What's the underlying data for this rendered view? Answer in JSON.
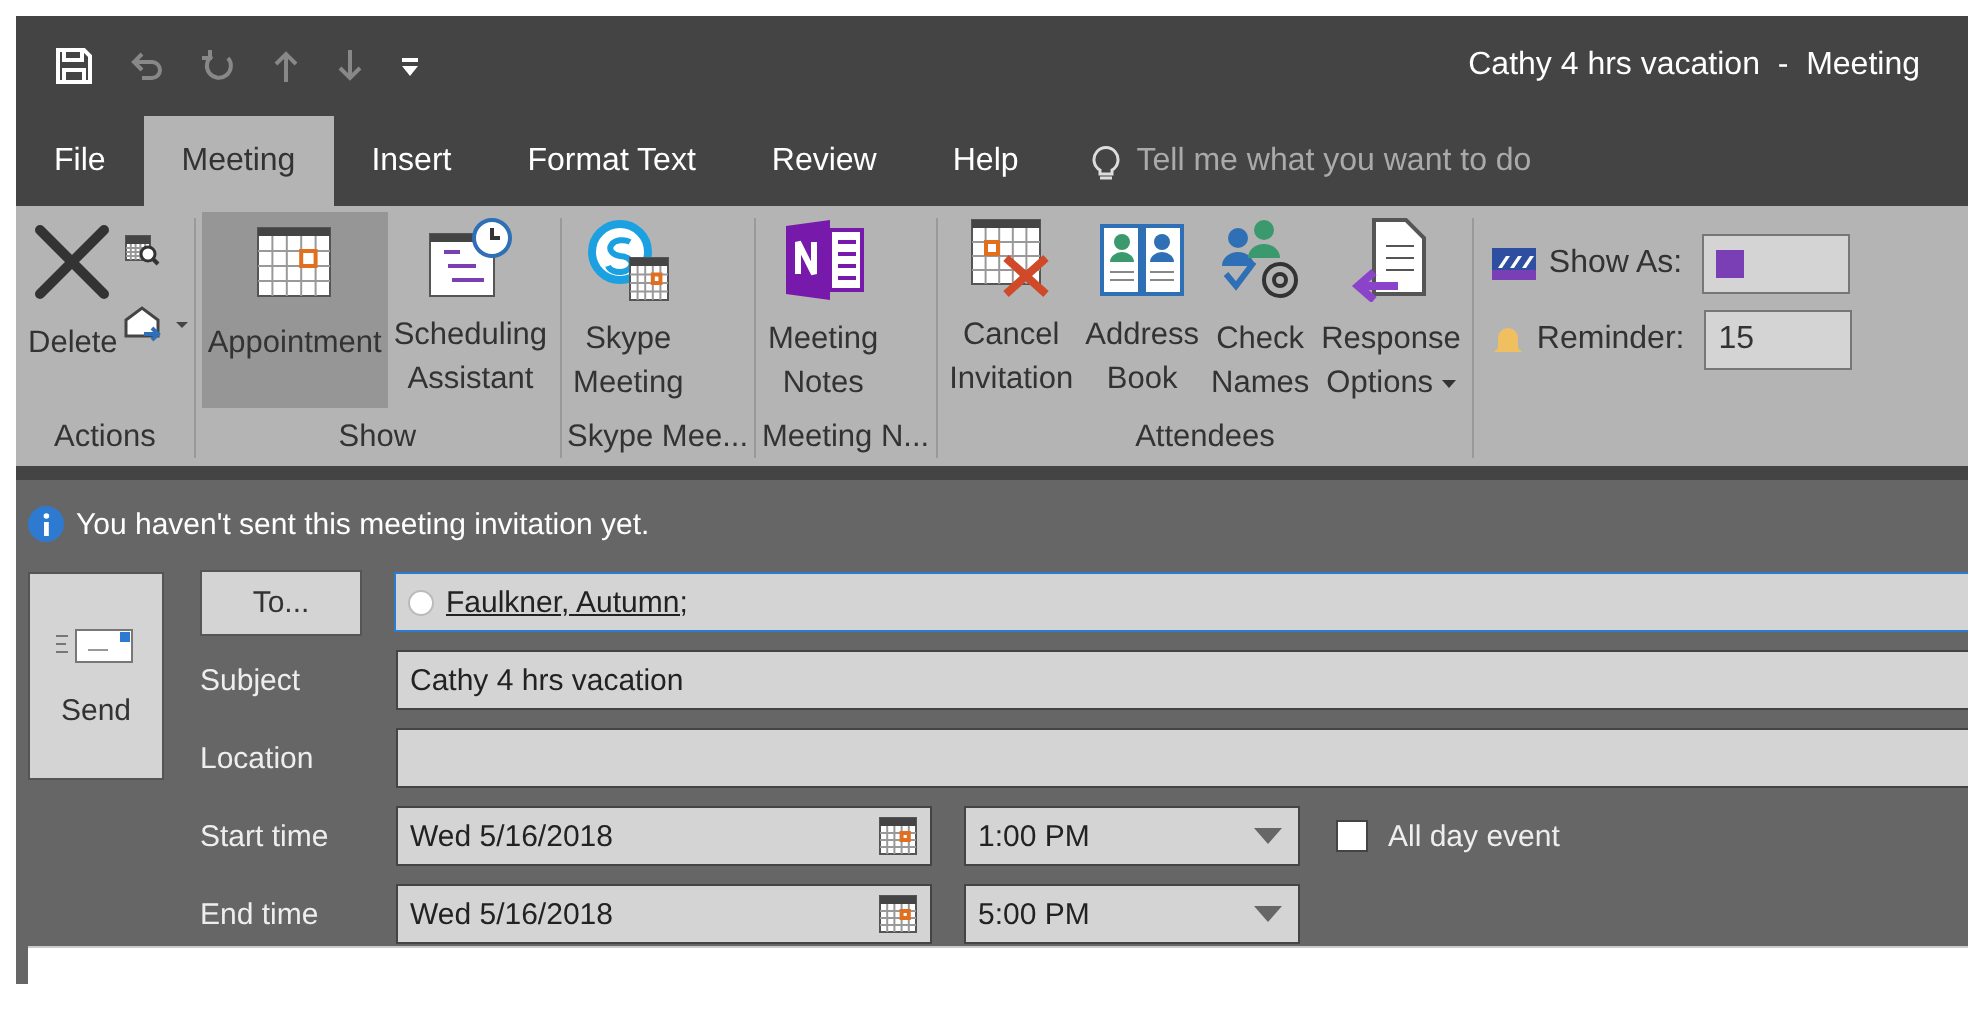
{
  "window": {
    "title": "Cathy 4 hrs vacation  -  Meeting"
  },
  "quick_access": [
    {
      "kind": "save",
      "disabled": false
    },
    {
      "kind": "undo",
      "disabled": true
    },
    {
      "kind": "redo",
      "disabled": true
    },
    {
      "kind": "up",
      "disabled": true
    },
    {
      "kind": "down",
      "disabled": true
    },
    {
      "kind": "customize",
      "disabled": false
    }
  ],
  "tabs": [
    {
      "label": "File",
      "selected": false
    },
    {
      "label": "Meeting",
      "selected": true
    },
    {
      "label": "Insert",
      "selected": false
    },
    {
      "label": "Format Text",
      "selected": false
    },
    {
      "label": "Review",
      "selected": false
    },
    {
      "label": "Help",
      "selected": false
    }
  ],
  "tell_me": {
    "placeholder": "Tell me what you want to do"
  },
  "ribbon": {
    "groups": [
      {
        "label": "Actions",
        "kind": "actions",
        "buttons": [
          {
            "kind": "delete",
            "lines": [
              "Delete"
            ],
            "selected": false
          }
        ]
      },
      {
        "label": "Show",
        "kind": "large",
        "buttons": [
          {
            "kind": "appointment",
            "lines": [
              "Appointment"
            ],
            "selected": true
          },
          {
            "kind": "scheduling",
            "lines": [
              "Scheduling",
              "Assistant"
            ],
            "selected": false
          }
        ]
      },
      {
        "label": "Skype Mee...",
        "kind": "large",
        "buttons": [
          {
            "kind": "skype",
            "lines": [
              "Skype",
              "Meeting"
            ],
            "selected": false
          }
        ]
      },
      {
        "label": "Meeting N...",
        "kind": "large",
        "buttons": [
          {
            "kind": "notes",
            "lines": [
              "Meeting",
              "Notes"
            ],
            "selected": false
          }
        ]
      },
      {
        "label": "Attendees",
        "kind": "large",
        "buttons": [
          {
            "kind": "cancel",
            "lines": [
              "Cancel",
              "Invitation"
            ],
            "selected": false
          },
          {
            "kind": "addressbook",
            "lines": [
              "Address",
              "Book"
            ],
            "selected": false
          },
          {
            "kind": "checknames",
            "lines": [
              "Check",
              "Names"
            ],
            "selected": false
          },
          {
            "kind": "response",
            "lines": [
              "Response",
              "Options"
            ],
            "dropdown": true,
            "selected": false
          }
        ]
      },
      {
        "kind": "options",
        "rows": [
          {
            "kind": "showas",
            "label": "Show As:"
          },
          {
            "kind": "reminder",
            "label": "Reminder:",
            "value": "15"
          }
        ]
      }
    ]
  },
  "info_bar": {
    "text": "You haven't sent this meeting invitation yet."
  },
  "form": {
    "send": "Send",
    "to_button": "To...",
    "recipients": "Faulkner, Autumn;",
    "subject": {
      "label": "Subject",
      "value": "Cathy 4 hrs vacation"
    },
    "location": {
      "label": "Location"
    },
    "start": {
      "label": "Start time",
      "date": "Wed 5/16/2018",
      "time": "1:00 PM"
    },
    "end": {
      "label": "End time",
      "date": "Wed 5/16/2018",
      "time": "5:00 PM"
    },
    "all_day": {
      "label": "All day event",
      "checked": false
    }
  }
}
